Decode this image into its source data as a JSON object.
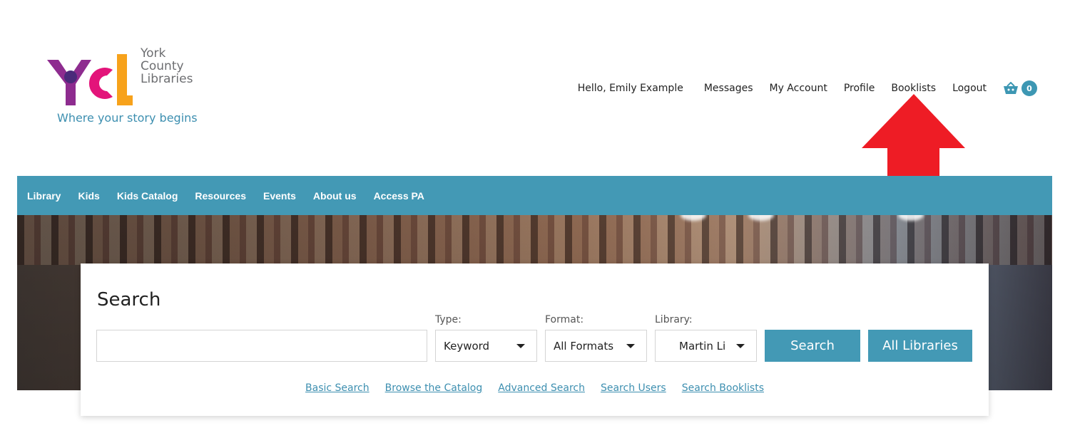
{
  "logo": {
    "mark": "YCL",
    "line1": "York",
    "line2": "County",
    "line3": "Libraries",
    "tagline": "Where your story begins"
  },
  "user_nav": {
    "greeting": "Hello, Emily Example",
    "links": [
      "Messages",
      "My Account",
      "Profile",
      "Booklists",
      "Logout"
    ],
    "cart_icon": "basket-icon",
    "cart_count": "0"
  },
  "annotation": {
    "arrow_icon": "red-arrow-up-icon",
    "arrow_color": "#ee1c25"
  },
  "main_nav": {
    "items": [
      "Library",
      "Kids",
      "Kids Catalog",
      "Resources",
      "Events",
      "About us",
      "Access PA"
    ]
  },
  "search": {
    "title": "Search",
    "input_value": "",
    "type_label": "Type:",
    "type_value": "Keyword",
    "format_label": "Format:",
    "format_value": "All Formats",
    "library_label": "Library:",
    "library_value": "Martin Li",
    "search_button": "Search",
    "all_libraries_button": "All Libraries",
    "links": [
      "Basic Search",
      "Browse the Catalog",
      "Advanced Search",
      "Search Users",
      "Search Booklists"
    ]
  },
  "colors": {
    "accent": "#4399b5",
    "link": "#3d8fb0",
    "arrow": "#ee1c25"
  }
}
